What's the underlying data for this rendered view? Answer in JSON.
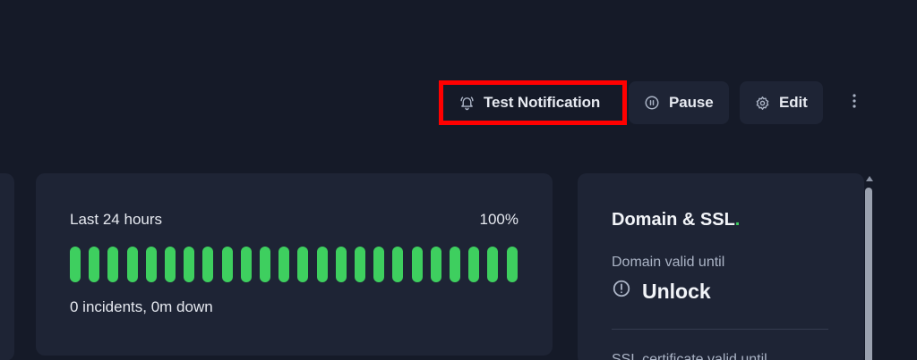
{
  "toolbar": {
    "test_notification_label": "Test Notification",
    "pause_label": "Pause",
    "edit_label": "Edit",
    "highlight_color": "#ff0000"
  },
  "uptime": {
    "period_label": "Last 24 hours",
    "percent_label": "100%",
    "uptime_percent": 100,
    "bar_count": 24,
    "bar_color": "#3ecf5f",
    "summary": "0 incidents, 0m down"
  },
  "domain_ssl": {
    "title": "Domain & SSL",
    "title_suffix": ".",
    "domain_label": "Domain valid until",
    "domain_value": "Unlock",
    "ssl_label": "SSL certificate valid until"
  },
  "icons": {
    "test": "bell-ring-icon",
    "pause": "pause-circle-icon",
    "edit": "gear-icon",
    "more": "more-vertical-icon",
    "info": "info-circle-icon"
  }
}
